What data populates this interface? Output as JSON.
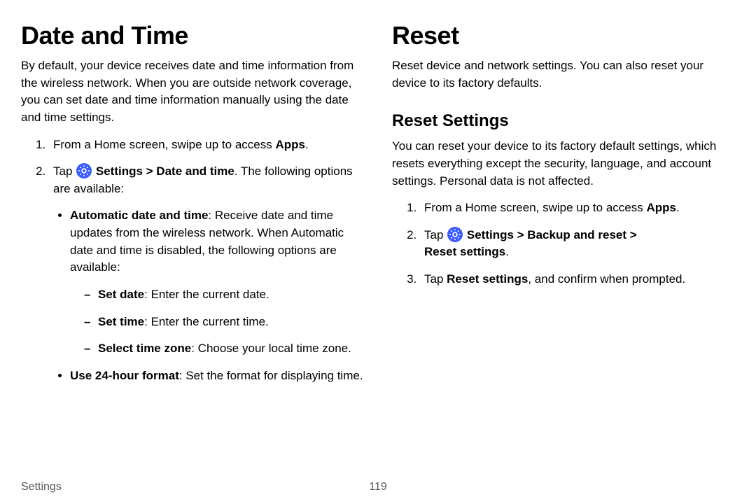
{
  "left": {
    "heading": "Date and Time",
    "intro": "By default, your device receives date and time information from the wireless network. When you are outside network coverage, you can set date and time information manually using the date and time settings.",
    "step1_pre": "From a Home screen, swipe up to access ",
    "step1_bold": "Apps",
    "step1_post": ".",
    "step2_pre": "Tap ",
    "step2_bold": "Settings > Date and time",
    "step2_post": ". The following options are available:",
    "b1_bold": "Automatic date and time",
    "b1_rest": ": Receive date and time updates from the wireless network. When Automatic date and time is disabled, the following options are available:",
    "d1_bold": "Set date",
    "d1_rest": ": Enter the current date.",
    "d2_bold": "Set time",
    "d2_rest": ": Enter the current time.",
    "d3_bold": "Select time zone",
    "d3_rest": ": Choose your local time zone.",
    "b2_bold": "Use 24-hour format",
    "b2_rest": ": Set the format for displaying time."
  },
  "right": {
    "heading": "Reset",
    "intro": "Reset device and network settings. You can also reset your device to its factory defaults.",
    "sub": "Reset Settings",
    "subintro": "You can reset your device to its factory default settings, which resets everything except the security, language, and account settings. Personal data is not affected.",
    "step1_pre": "From a Home screen, swipe up to access ",
    "step1_bold": "Apps",
    "step1_post": ".",
    "step2_pre": "Tap ",
    "step2_bold1": "Settings > Backup and reset > ",
    "step2_bold2": "Reset settings",
    "step2_post": ".",
    "step3_pre": "Tap ",
    "step3_bold": "Reset settings",
    "step3_post": ", and confirm when prompted."
  },
  "footer": {
    "label": "Settings",
    "page": "119"
  }
}
